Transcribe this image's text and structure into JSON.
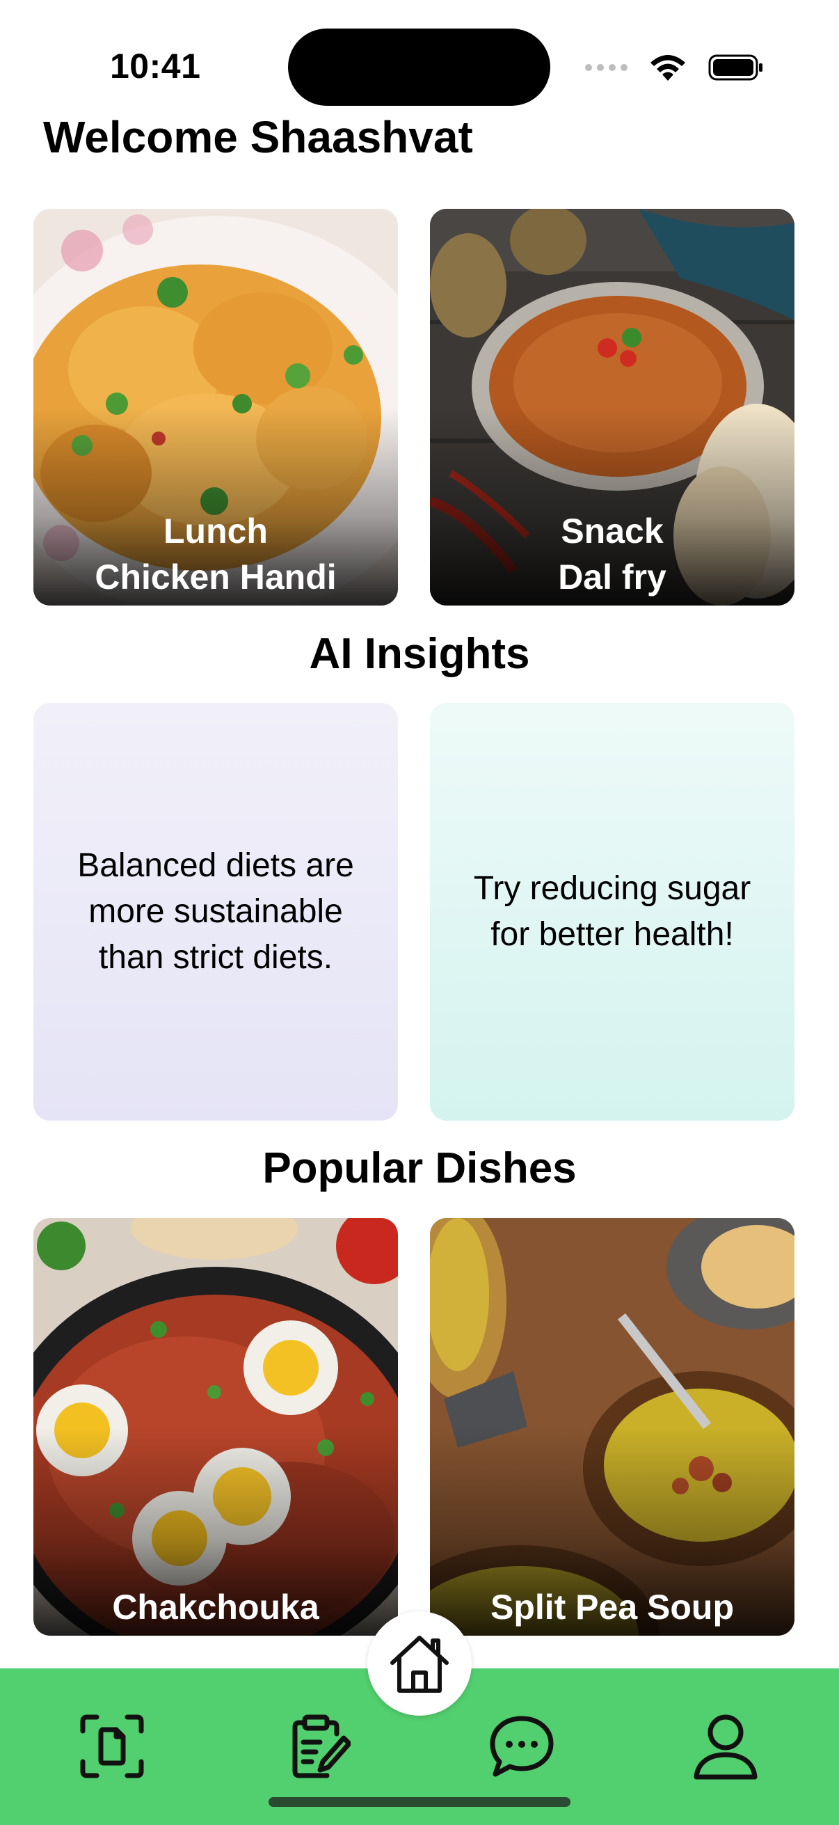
{
  "status_bar": {
    "time": "10:41",
    "icons": [
      "signal-dots-icon",
      "wifi-icon",
      "battery-icon"
    ]
  },
  "header": {
    "welcome": "Welcome Shaashvat"
  },
  "meals": [
    {
      "meal": "Lunch",
      "dish": "Chicken Handi",
      "image": "chicken-handi-photo"
    },
    {
      "meal": "Snack",
      "dish": "Dal fry",
      "image": "dal-fry-photo"
    }
  ],
  "ai_insights": {
    "title": "AI Insights",
    "items": [
      {
        "text": "Balanced diets are more sustainable than strict diets.",
        "color": "#e8e7f7"
      },
      {
        "text": "Try reducing sugar for better health!",
        "color": "#d9f5f1"
      }
    ]
  },
  "popular": {
    "title": "Popular Dishes",
    "items": [
      {
        "name": "Chakchouka",
        "image": "chakchouka-photo"
      },
      {
        "name": "Split Pea Soup",
        "image": "split-pea-soup-photo"
      }
    ]
  },
  "tab_bar": {
    "color": "#52cf6e",
    "tabs": [
      "scan-document-icon",
      "clipboard-edit-icon",
      "home-icon",
      "chat-bubble-icon",
      "profile-icon"
    ]
  }
}
